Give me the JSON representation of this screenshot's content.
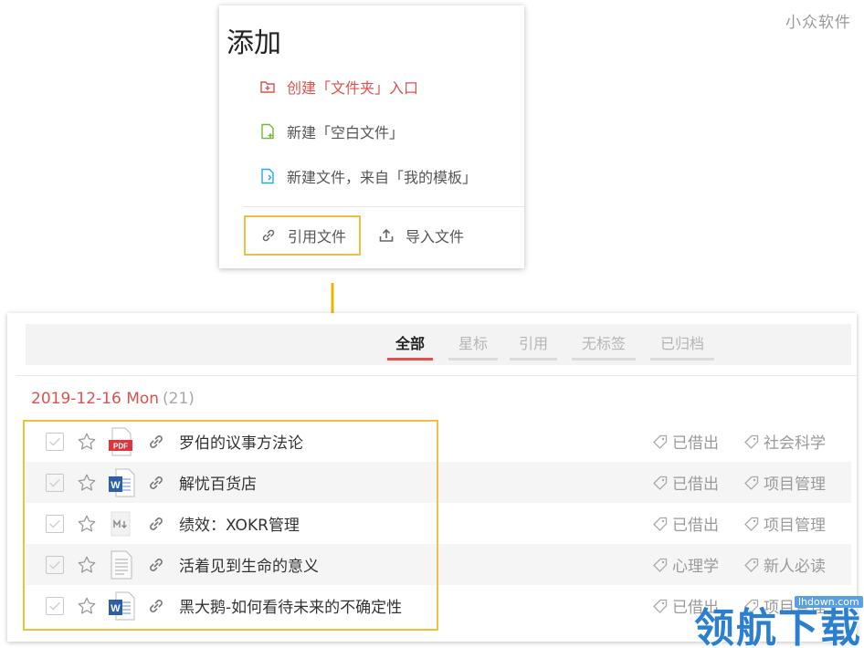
{
  "watermark_top": "小众软件",
  "popup": {
    "title": "添加",
    "items": [
      {
        "label": "创建「文件夹」入口",
        "icon": "folder-plus-icon",
        "color": "#d9534f"
      },
      {
        "label": "新建「空白文件」",
        "icon": "new-file-icon",
        "color": "#7cb342"
      },
      {
        "label": "新建文件，来自「我的模板」",
        "icon": "template-file-icon",
        "color": "#29a8e0"
      }
    ],
    "ref_button": "引用文件",
    "import_button": "导入文件"
  },
  "tabs": [
    {
      "label": "全部",
      "active": true
    },
    {
      "label": "星标",
      "active": false
    },
    {
      "label": "引用",
      "active": false
    },
    {
      "label": "无标签",
      "active": false
    },
    {
      "label": "已归档",
      "active": false
    }
  ],
  "group": {
    "date": "2019-12-16 Mon",
    "count": "(21)"
  },
  "rows": [
    {
      "title": "罗伯的议事方法论",
      "type": "pdf",
      "tags": [
        "已借出",
        "社会科学"
      ]
    },
    {
      "title": "解忧百货店",
      "type": "word",
      "tags": [
        "已借出",
        "项目管理"
      ]
    },
    {
      "title": "绩效：XOKR管理",
      "type": "markdown",
      "tags": [
        "已借出",
        "项目管理"
      ]
    },
    {
      "title": "活着见到生命的意义",
      "type": "text",
      "tags": [
        "心理学",
        "新人必读"
      ]
    },
    {
      "title": "黑大鹅-如何看待未来的不确定性",
      "type": "word",
      "tags": [
        "已借出",
        "项目管理"
      ]
    }
  ],
  "watermark_brand": "领航下载",
  "watermark_url": "lhdown.com",
  "colors": {
    "accent": "#d9534f",
    "highlight": "#f0c040",
    "word": "#2b5fa8",
    "pdf": "#d9363e"
  }
}
